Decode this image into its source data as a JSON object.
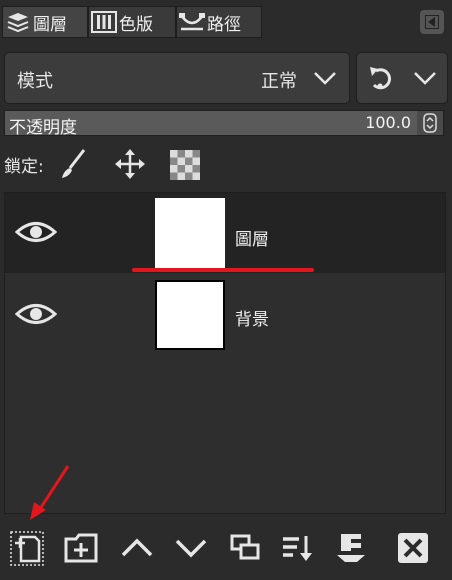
{
  "tabs": [
    {
      "label": "圖層",
      "icon": "layers-icon"
    },
    {
      "label": "色版",
      "icon": "channels-icon"
    },
    {
      "label": "路徑",
      "icon": "paths-icon"
    }
  ],
  "mode": {
    "label": "模式",
    "value": "正常"
  },
  "opacity": {
    "label": "不透明度",
    "value": "100.0"
  },
  "lock": {
    "label": "鎖定:"
  },
  "layers": [
    {
      "name": "圖層",
      "visible": true,
      "selected": true
    },
    {
      "name": "背景",
      "visible": true,
      "selected": false
    }
  ],
  "toolbar": [
    "new-layer",
    "new-layer-group",
    "raise-layer",
    "lower-layer",
    "duplicate-layer",
    "merge-down",
    "anchor-layer",
    "delete-layer"
  ],
  "colors": {
    "accent_red": "#e4161d",
    "panel": "#2b2b2b"
  }
}
